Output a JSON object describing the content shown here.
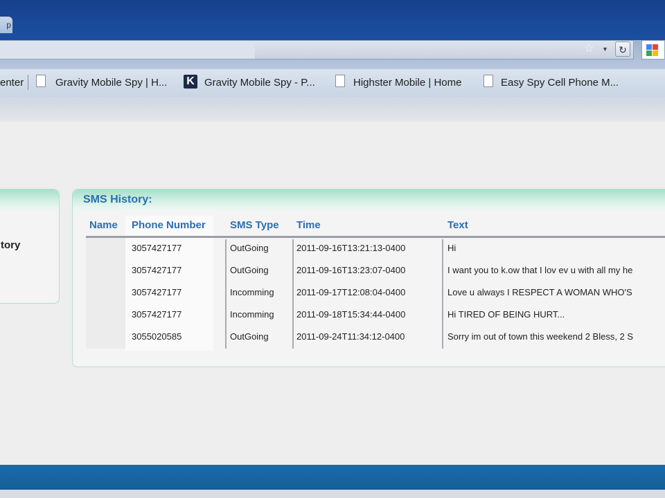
{
  "browser": {
    "tab_partial": "p",
    "bookmarks": [
      {
        "label": "enter"
      },
      {
        "label": "Gravity Mobile Spy | H..."
      },
      {
        "label": "Gravity Mobile Spy - P..."
      },
      {
        "label": "Highster Mobile | Home"
      },
      {
        "label": "Easy Spy Cell Phone M..."
      }
    ],
    "icons": {
      "star": "star-icon",
      "reload": "reload-icon",
      "google": "google-icon"
    }
  },
  "left_panel": {
    "label": "tory"
  },
  "sms": {
    "title": "SMS History:",
    "columns": [
      "Name",
      "Phone Number",
      "SMS Type",
      "Time",
      "Text"
    ],
    "rows": [
      {
        "name": "",
        "phone": "3057427177",
        "type": "OutGoing",
        "time": "2011-09-16T13:21:13-0400",
        "text": "Hi"
      },
      {
        "name": "",
        "phone": "3057427177",
        "type": "OutGoing",
        "time": "2011-09-16T13:23:07-0400",
        "text": "I want you to k.ow that I lov ev u with all my he"
      },
      {
        "name": "",
        "phone": "3057427177",
        "type": "Incomming",
        "time": "2011-09-17T12:08:04-0400",
        "text": "Love u always I RESPECT A WOMAN WHO'S"
      },
      {
        "name": "",
        "phone": "3057427177",
        "type": "Incomming",
        "time": "2011-09-18T15:34:44-0400",
        "text": "Hi TIRED OF BEING HURT..."
      },
      {
        "name": "",
        "phone": "3055020585",
        "type": "OutGoing",
        "time": "2011-09-24T11:34:12-0400",
        "text": "Sorry im out of town this weekend 2 Bless, 2 S"
      }
    ]
  },
  "colors": {
    "accent": "#2a6fb0",
    "header_green": "#a6e0c9",
    "titlebar": "#1a4a9a",
    "statusbar": "#1b6aa8"
  }
}
